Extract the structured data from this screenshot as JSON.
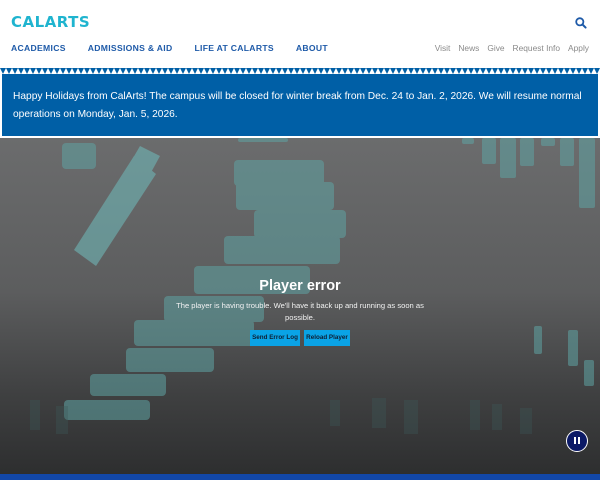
{
  "header": {
    "logo_text": "CALARTS",
    "search_icon": "search-icon"
  },
  "nav": {
    "items": [
      {
        "label": "ACADEMICS"
      },
      {
        "label": "ADMISSIONS & AID"
      },
      {
        "label": "LIFE AT CALARTS"
      },
      {
        "label": "ABOUT"
      }
    ]
  },
  "utility_nav": {
    "items": [
      {
        "label": "Visit"
      },
      {
        "label": "News"
      },
      {
        "label": "Give"
      },
      {
        "label": "Request Info"
      },
      {
        "label": "Apply"
      }
    ]
  },
  "notice": {
    "text": "Happy Holidays from CalArts! The campus will be closed for winter break from Dec. 24 to Jan. 2, 2026. We will resume normal operations on Monday, Jan. 5, 2026."
  },
  "player": {
    "error_title": "Player error",
    "error_message": "The player is having trouble. We'll have it back up and running as soon as possible.",
    "send_log_label": "Send Error Log",
    "reload_label": "Reload Player",
    "pause_icon": "pause-icon"
  },
  "colors": {
    "brand_cyan": "#1fb4cf",
    "nav_blue": "#1e5aa8",
    "notice_blue": "#005fa6",
    "button_blue": "#0aa3e6",
    "pause_navy": "#0c1a66"
  }
}
